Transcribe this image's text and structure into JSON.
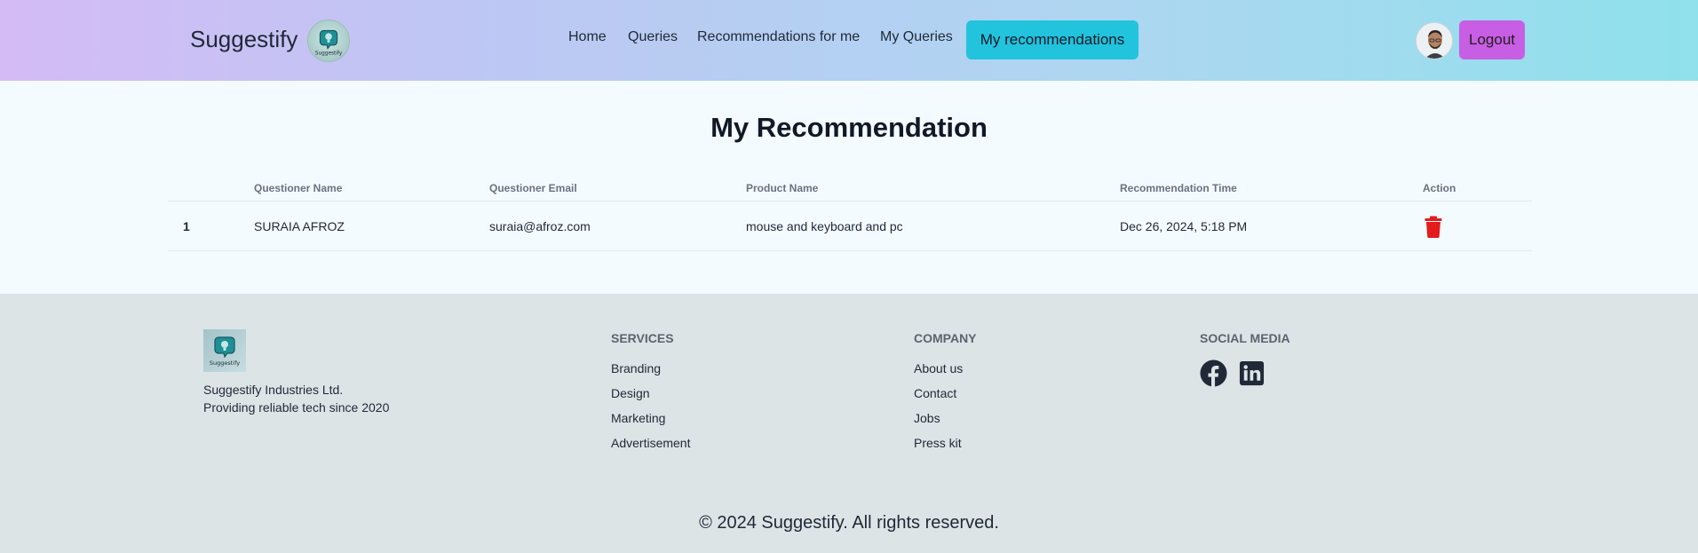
{
  "navbar": {
    "brand": "Suggestify",
    "links": [
      "Home",
      "Queries",
      "Recommendations for me",
      "My Queries"
    ],
    "active_link": "My recommendations",
    "logout_label": "Logout",
    "colors": {
      "active": "#22c3dd",
      "logout": "#c85ee3"
    }
  },
  "main": {
    "title": "My Recommendation",
    "table": {
      "headers": [
        "Questioner Name",
        "Questioner Email",
        "Product Name",
        "Recommendation Time",
        "Action"
      ],
      "rows": [
        {
          "index": "1",
          "name": "SURAIA AFROZ",
          "email": "suraia@afroz.com",
          "product": "mouse and keyboard and pc",
          "time": "Dec 26, 2024, 5:18 PM",
          "action_icon": "trash-icon"
        }
      ]
    }
  },
  "footer": {
    "company_line1": "Suggestify Industries Ltd.",
    "company_line2": "Providing reliable tech since 2020",
    "services": {
      "title": "SERVICES",
      "items": [
        "Branding",
        "Design",
        "Marketing",
        "Advertisement"
      ]
    },
    "company": {
      "title": "COMPANY",
      "items": [
        "About us",
        "Contact",
        "Jobs",
        "Press kit"
      ]
    },
    "social": {
      "title": "SOCIAL MEDIA",
      "icons": [
        "facebook-icon",
        "linkedin-icon"
      ]
    },
    "copyright": "© 2024 Suggestify. All rights reserved."
  }
}
